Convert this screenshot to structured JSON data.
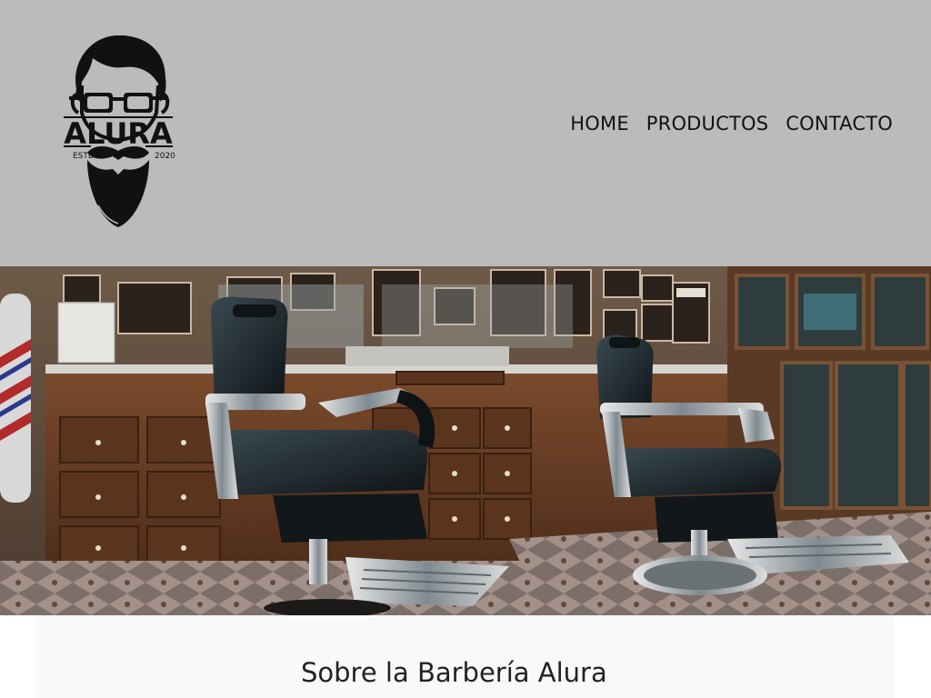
{
  "header": {
    "logo": {
      "brand": "ALURA",
      "left_text": "ESTD",
      "right_text": "2020"
    },
    "nav": [
      {
        "label": "HOME"
      },
      {
        "label": "PRODUCTOS"
      },
      {
        "label": "CONTACTO"
      }
    ]
  },
  "hero": {
    "image_alt": "Interior de barbería con sillones de barbero"
  },
  "about": {
    "title": "Sobre la Barbería Alura"
  },
  "colors": {
    "header_bg": "#bbbbbb",
    "text": "#111111",
    "content_bg": "#f9f9f9"
  }
}
